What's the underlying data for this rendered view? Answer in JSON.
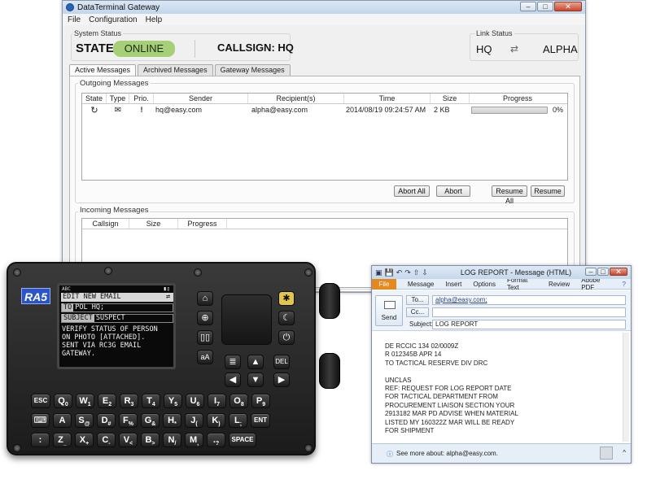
{
  "gateway": {
    "title": "DataTerminal Gateway",
    "menu": [
      "File",
      "Configuration",
      "Help"
    ],
    "system_status": {
      "group_label": "System Status",
      "state_label": "STATE:",
      "state_value": "ONLINE",
      "state_color": "#a6cf78",
      "callsign_label": "CALLSIGN: HQ"
    },
    "link_status": {
      "group_label": "Link Status",
      "from": "HQ",
      "to": "ALPHA",
      "icon": "link-arrows-icon"
    },
    "tabs": [
      "Active Messages",
      "Archived Messages",
      "Gateway Messages"
    ],
    "outgoing": {
      "group_label": "Outgoing Messages",
      "columns": [
        "State",
        "Type",
        "Prio.",
        "Sender",
        "Recipient(s)",
        "Time",
        "Size",
        "Progress"
      ],
      "rows": [
        {
          "state_icon": "refresh-icon",
          "type_icon": "envelope-icon",
          "prio": "!",
          "sender": "hq@easy.com",
          "recipient": "alpha@easy.com",
          "time": "2014/08/19 09:24:57 AM",
          "size": "2 KB",
          "progress_fraction": 0,
          "progress_text": "0%"
        }
      ],
      "buttons": [
        "Abort All",
        "Abort",
        "Resume All",
        "Resume"
      ]
    },
    "incoming": {
      "group_label": "Incoming Messages",
      "columns": [
        "Callsign",
        "Size",
        "Progress"
      ]
    }
  },
  "radio": {
    "logo": "RA5",
    "screen": {
      "mode": "ABC",
      "title": "EDIT NEW EMAIL",
      "to_label": "TO",
      "to_value": "POL HQ;",
      "subject_label": "SUBJECT",
      "subject_value": "SUSPECT",
      "body": [
        "VERIFY STATUS OF PERSON",
        "ON PHOTO [ATTACHED].",
        "SENT VIA RC3G EMAIL",
        "GATEWAY."
      ]
    },
    "keys": {
      "row1": [
        [
          "ESC",
          ""
        ],
        [
          "Q",
          "0"
        ],
        [
          "W",
          "1"
        ],
        [
          "E",
          "2"
        ],
        [
          "R",
          "3"
        ],
        [
          "T",
          "4"
        ],
        [
          "Y",
          "5"
        ],
        [
          "U",
          "6"
        ],
        [
          "I",
          "7"
        ],
        [
          "O",
          "8"
        ],
        [
          "P",
          "9"
        ]
      ],
      "row2": [
        [
          "⌨",
          ""
        ],
        [
          "A",
          ""
        ],
        [
          "S",
          "@"
        ],
        [
          "D",
          "#"
        ],
        [
          "F",
          "%"
        ],
        [
          "G",
          "&"
        ],
        [
          "H",
          "*"
        ],
        [
          "J",
          "("
        ],
        [
          "K",
          ")"
        ],
        [
          "L",
          ";"
        ],
        [
          "ENT",
          ""
        ]
      ],
      "row3": [
        [
          ":",
          ""
        ],
        [
          "Z",
          "_"
        ],
        [
          "X",
          "+"
        ],
        [
          "C",
          "-"
        ],
        [
          "V",
          "<"
        ],
        [
          "B",
          ">"
        ],
        [
          "N",
          "/"
        ],
        [
          "M",
          ","
        ],
        [
          ".",
          "?"
        ],
        [
          "SPACE",
          ""
        ]
      ],
      "del": "DEL",
      "font_key": "aA"
    }
  },
  "outlook": {
    "title": "LOG REPORT - Message (HTML)",
    "ribbon_tabs": [
      "File",
      "Message",
      "Insert",
      "Options",
      "Format Text",
      "Review",
      "Adobe PDF"
    ],
    "send_label": "Send",
    "to_button": "To...",
    "cc_button": "Cc...",
    "subject_label": "Subject:",
    "to_value": "alpha@easy.com;",
    "cc_value": "",
    "subject_value": "LOG REPORT",
    "body": [
      "DE RCCIC 134 02/0009Z",
      "R 012345B APR 14",
      "TO TACTICAL RESERVE DIV DRC",
      "",
      "UNCLAS",
      "REF: REQUEST FOR LOG REPORT DATE",
      "FOR TACTICAL DEPARTMENT FROM",
      "PROCUREMENT LIAISON SECTION YOUR",
      "2913182 MAR PD ADVISE WHEN MATERIAL",
      "LISTED MY 160322Z MAR WILL BE READY",
      "FOR SHIPMENT"
    ],
    "footer_text": "See more about: alpha@easy.com."
  }
}
